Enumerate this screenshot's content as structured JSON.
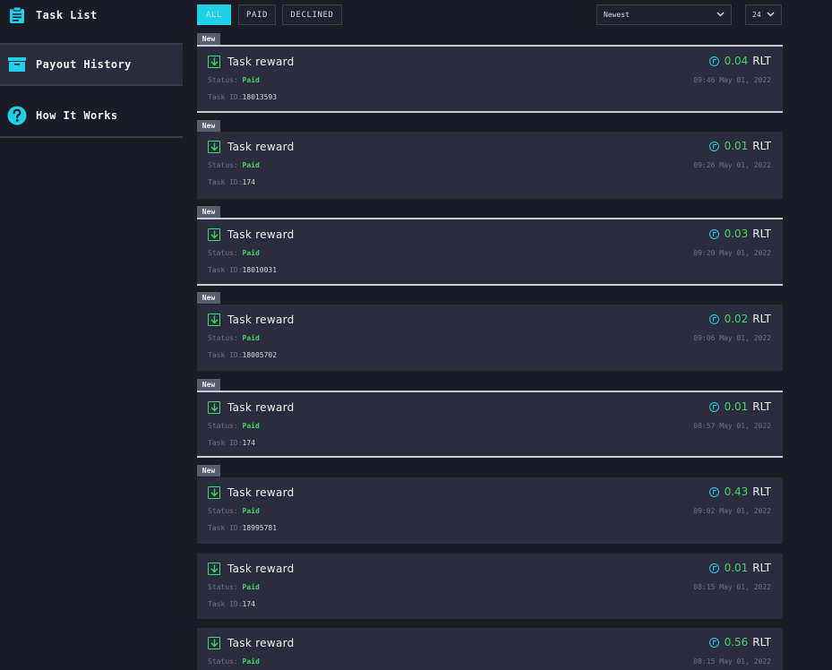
{
  "sidebar": {
    "items": [
      {
        "label": "Task List",
        "icon": "clipboard-icon"
      },
      {
        "label": "Payout History",
        "icon": "archive-box-icon"
      },
      {
        "label": "How It Works",
        "icon": "question-icon"
      }
    ]
  },
  "filters": {
    "buttons": [
      {
        "label": "ALL"
      },
      {
        "label": "PAID"
      },
      {
        "label": "DECLINED"
      }
    ],
    "sort_select": {
      "value": "Newest"
    },
    "page_size_select": {
      "value": "24"
    }
  },
  "payouts": [
    {
      "badge": "New",
      "title": "Task reward",
      "status_label": "Status:",
      "status": "Paid",
      "task_id_label": "Task ID:",
      "task_id": "18013593",
      "amount": "0.04",
      "unit": "RLT",
      "date": "09:46 May 01, 2022"
    },
    {
      "badge": "New",
      "title": "Task reward",
      "status_label": "Status:",
      "status": "Paid",
      "task_id_label": "Task ID:",
      "task_id": "174",
      "amount": "0.01",
      "unit": "RLT",
      "date": "09:26 May 01, 2022"
    },
    {
      "badge": "New",
      "title": "Task reward",
      "status_label": "Status:",
      "status": "Paid",
      "task_id_label": "Task ID:",
      "task_id": "18010031",
      "amount": "0.03",
      "unit": "RLT",
      "date": "09:20 May 01, 2022"
    },
    {
      "badge": "New",
      "title": "Task reward",
      "status_label": "Status:",
      "status": "Paid",
      "task_id_label": "Task ID:",
      "task_id": "18005702",
      "amount": "0.02",
      "unit": "RLT",
      "date": "09:06 May 01, 2022"
    },
    {
      "badge": "New",
      "title": "Task reward",
      "status_label": "Status:",
      "status": "Paid",
      "task_id_label": "Task ID:",
      "task_id": "174",
      "amount": "0.01",
      "unit": "RLT",
      "date": "08:57 May 01, 2022"
    },
    {
      "badge": "New",
      "title": "Task reward",
      "status_label": "Status:",
      "status": "Paid",
      "task_id_label": "Task ID:",
      "task_id": "18995781",
      "amount": "0.43",
      "unit": "RLT",
      "date": "09:02 May 01, 2022"
    },
    {
      "badge": "",
      "title": "Task reward",
      "status_label": "Status:",
      "status": "Paid",
      "task_id_label": "Task ID:",
      "task_id": "174",
      "amount": "0.01",
      "unit": "RLT",
      "date": "08:15 May 01, 2022"
    },
    {
      "badge": "",
      "title": "Task reward",
      "status_label": "Status:",
      "status": "Paid",
      "task_id_label": "Task ID:",
      "task_id": "",
      "amount": "0.56",
      "unit": "RLT",
      "date": "08:15 May 01, 2022"
    }
  ]
}
